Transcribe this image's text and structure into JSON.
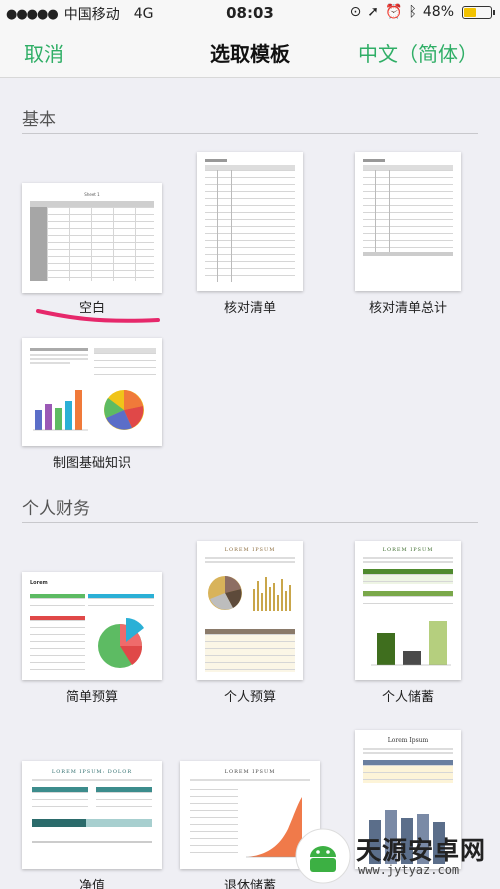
{
  "status_bar": {
    "signal": "●●●●●",
    "carrier": "中国移动",
    "network": "4G",
    "time": "08:03",
    "battery_percent": "48%",
    "battery_level": 0.48,
    "battery_color": "#f2c200"
  },
  "nav": {
    "cancel_label": "取消",
    "title": "选取模板",
    "language_label": "中文（简体）",
    "accent_color": "#2fae66"
  },
  "sections": [
    {
      "title": "基本",
      "templates": [
        {
          "label": "空白",
          "thumb_title": "Sheet 1"
        },
        {
          "label": "核对清单"
        },
        {
          "label": "核对清单总计"
        },
        {
          "label": "制图基础知识"
        }
      ]
    },
    {
      "title": "个人财务",
      "templates": [
        {
          "label": "简单预算",
          "thumb_title": "Lorem"
        },
        {
          "label": "个人预算",
          "thumb_title": "LOREM IPSUM"
        },
        {
          "label": "个人储蓄",
          "thumb_title": "LOREM IPSUM"
        },
        {
          "label": "净值",
          "thumb_title": "LOREM IPSUM: DOLOR"
        },
        {
          "label": "退休储蓄",
          "thumb_title": "LOREM IPSUM"
        },
        {
          "label": "",
          "thumb_title": "Lorem Ipsum"
        }
      ]
    }
  ],
  "watermark": {
    "brand": "天源安卓网",
    "url": "www.jytyaz.com"
  }
}
